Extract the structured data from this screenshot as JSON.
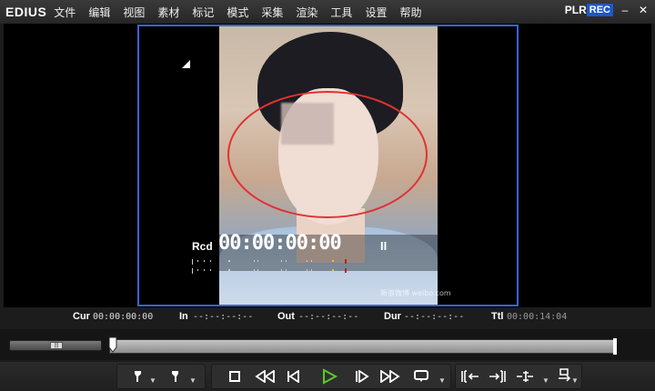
{
  "app": {
    "logo": "EDIUS",
    "menu": [
      "文件",
      "编辑",
      "视图",
      "素材",
      "标记",
      "模式",
      "采集",
      "渲染",
      "工具",
      "设置",
      "帮助"
    ],
    "plr": "PLR",
    "rec": "REC",
    "minimize": "–",
    "close": "✕"
  },
  "overlay": {
    "rcd_label": "Rcd",
    "timecode": "00:00:00:00",
    "pause_glyph": "II",
    "watermark": "新浪微博 weibo.com"
  },
  "timecodes": {
    "cur_label": "Cur",
    "cur_value": "00:00:00:00",
    "in_label": "In",
    "in_value": "--:--:--:--",
    "out_label": "Out",
    "out_value": "--:--:--:--",
    "dur_label": "Dur",
    "dur_value": "--:--:--:--",
    "ttl_label": "Ttl",
    "ttl_value": "00:00:14:04"
  },
  "colors": {
    "frame_border": "#3b63d6",
    "annotation": "#e03232",
    "rec_badge": "#1e57c9",
    "play_button": "#5ec72a"
  },
  "playback": {
    "set_in": "in-point-icon",
    "set_out": "out-point-icon",
    "stop": "stop-icon",
    "rewind": "rewind-icon",
    "step_back": "step-back-icon",
    "play": "play-icon",
    "step_forward": "step-forward-icon",
    "fast_forward": "fast-forward-icon",
    "loop": "loop-icon",
    "insert": "insert-icon",
    "overwrite": "overwrite-icon",
    "trim": "trim-icon",
    "ripple": "ripple-icon"
  }
}
